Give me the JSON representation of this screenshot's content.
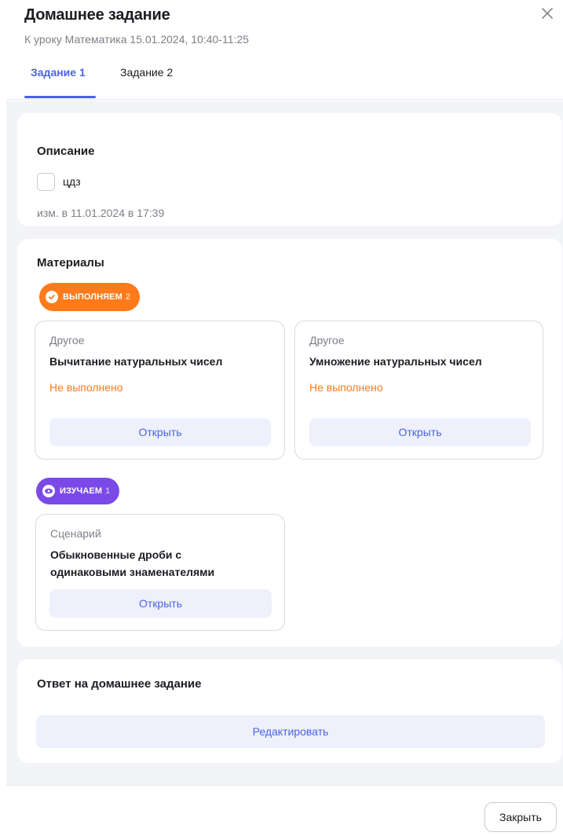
{
  "dialog": {
    "title": "Домашнее задание",
    "subtitle": "К уроку Математика 15.01.2024, 10:40-11:25",
    "close_icon": "close-icon"
  },
  "tabs": [
    {
      "label": "Задание 1",
      "active": true
    },
    {
      "label": "Задание 2",
      "active": false
    }
  ],
  "description": {
    "title": "Описание",
    "checkbox_label": "цдз",
    "checked": false,
    "edited": "изм. в 11.01.2024 в 17:39"
  },
  "materials": {
    "title": "Материалы",
    "groups": [
      {
        "badge_label": "ВЫПОЛНЯЕМ",
        "badge_count": "2",
        "badge_icon": "check-circle-icon",
        "badge_color": "#ff7a1a",
        "items": [
          {
            "type": "Другое",
            "name": "Вычитание натуральных чисел",
            "status": "Не выполнено",
            "button": "Открыть"
          },
          {
            "type": "Другое",
            "name": "Умножение натуральных чисел",
            "status": "Не выполнено",
            "button": "Открыть"
          }
        ]
      },
      {
        "badge_label": "ИЗУЧАЕМ",
        "badge_count": "1",
        "badge_icon": "eye-icon",
        "badge_color": "#7a49e8",
        "items": [
          {
            "type": "Сценарий",
            "name": "Обыкновенные дроби с одинаковыми знаменателями",
            "button": "Открыть"
          }
        ]
      }
    ]
  },
  "answer": {
    "title": "Ответ на домашнее задание",
    "edit_button": "Редактировать"
  },
  "footer": {
    "close_button": "Закрыть"
  },
  "colors": {
    "accent": "#4a63e6",
    "warning": "#ff7a1a",
    "purple": "#7a49e8"
  }
}
